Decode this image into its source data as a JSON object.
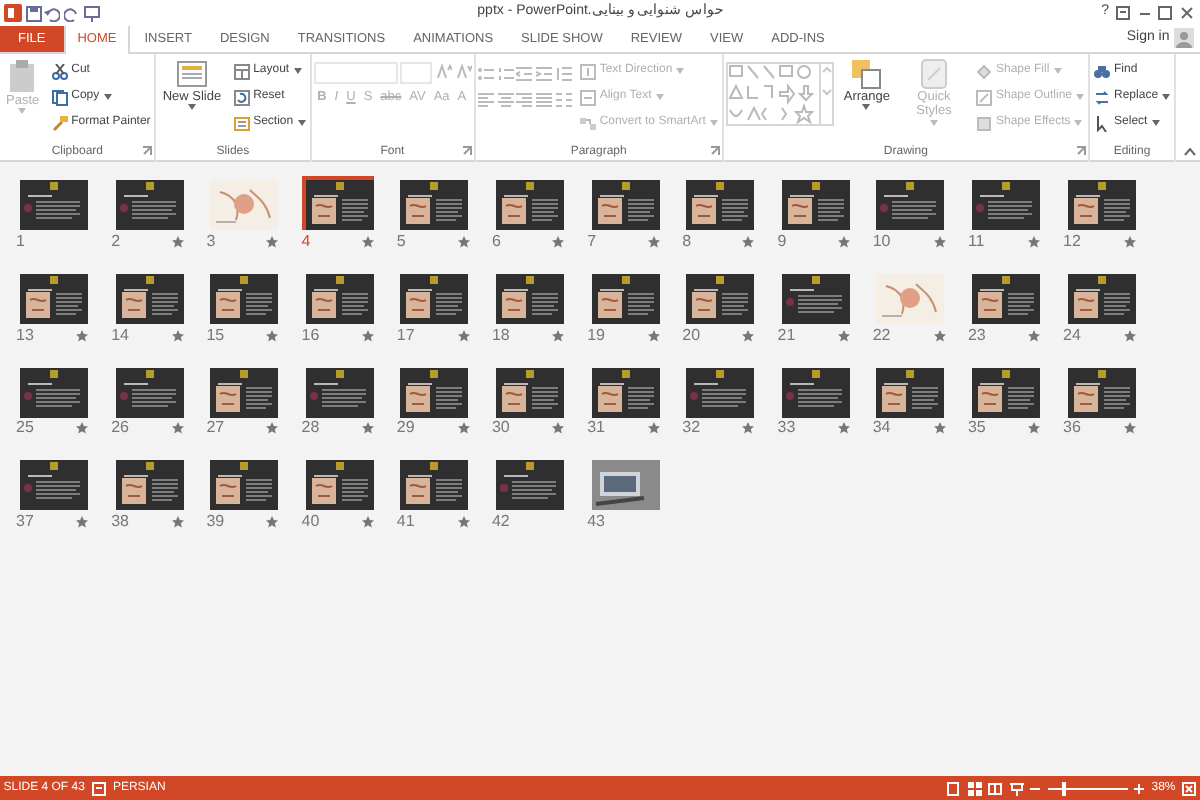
{
  "window": {
    "title": "حواس شنوایی و بینایی.pptx - PowerPoint",
    "help": "?",
    "sign_in": "Sign in"
  },
  "tabs": [
    {
      "label": "FILE",
      "kind": "file",
      "selected": false
    },
    {
      "label": "HOME",
      "kind": "tab",
      "selected": true
    },
    {
      "label": "INSERT",
      "kind": "tab",
      "selected": false
    },
    {
      "label": "DESIGN",
      "kind": "tab",
      "selected": false
    },
    {
      "label": "TRANSITIONS",
      "kind": "tab",
      "selected": false
    },
    {
      "label": "ANIMATIONS",
      "kind": "tab",
      "selected": false
    },
    {
      "label": "SLIDE SHOW",
      "kind": "tab",
      "selected": false
    },
    {
      "label": "REVIEW",
      "kind": "tab",
      "selected": false
    },
    {
      "label": "VIEW",
      "kind": "tab",
      "selected": false
    },
    {
      "label": "ADD-INS",
      "kind": "tab",
      "selected": false
    }
  ],
  "ribbon": {
    "groups": [
      {
        "label": "Clipboard",
        "launcher": true,
        "items": [
          {
            "kind": "large",
            "label": "Paste",
            "disabled": true,
            "dropdown": true
          },
          {
            "kind": "stack",
            "buttons": [
              {
                "label": "Cut",
                "disabled": false,
                "dropdown": false
              },
              {
                "label": "Copy",
                "disabled": false,
                "dropdown": true
              },
              {
                "label": "Format Painter",
                "disabled": false,
                "dropdown": false
              }
            ]
          }
        ]
      },
      {
        "label": "Slides",
        "launcher": false,
        "items": [
          {
            "kind": "large",
            "label": "New Slide",
            "disabled": false,
            "dropdown": true
          },
          {
            "kind": "stack",
            "buttons": [
              {
                "label": "Layout",
                "disabled": false,
                "dropdown": true
              },
              {
                "label": "Reset",
                "disabled": false,
                "dropdown": false
              },
              {
                "label": "Section",
                "disabled": false,
                "dropdown": true
              }
            ]
          }
        ]
      },
      {
        "label": "Font",
        "launcher": true,
        "items": [
          {
            "kind": "font",
            "disabled": true,
            "format_buttons": [
              "B",
              "I",
              "U",
              "S",
              "abc",
              "AV",
              "Aa",
              "A"
            ]
          }
        ]
      },
      {
        "label": "Paragraph",
        "launcher": true,
        "items": [
          {
            "kind": "paragraph",
            "disabled": true
          },
          {
            "kind": "stack",
            "buttons": [
              {
                "label": "Text Direction",
                "disabled": true,
                "dropdown": true
              },
              {
                "label": "Align Text",
                "disabled": true,
                "dropdown": true
              },
              {
                "label": "Convert to SmartArt",
                "disabled": true,
                "dropdown": true
              }
            ]
          }
        ]
      },
      {
        "label": "Drawing",
        "launcher": true,
        "items": [
          {
            "kind": "gallery",
            "disabled": true
          },
          {
            "kind": "large",
            "label": "Arrange",
            "disabled": false,
            "dropdown": true
          },
          {
            "kind": "large",
            "label": "Quick Styles",
            "disabled": true,
            "dropdown": true
          },
          {
            "kind": "stack",
            "buttons": [
              {
                "label": "Shape Fill",
                "disabled": true,
                "dropdown": true
              },
              {
                "label": "Shape Outline",
                "disabled": true,
                "dropdown": true
              },
              {
                "label": "Shape Effects",
                "disabled": true,
                "dropdown": true
              }
            ]
          }
        ]
      },
      {
        "label": "Editing",
        "launcher": false,
        "items": [
          {
            "kind": "stack",
            "buttons": [
              {
                "label": "Find",
                "disabled": false,
                "dropdown": false
              },
              {
                "label": "Replace",
                "disabled": false,
                "dropdown": true
              },
              {
                "label": "Select",
                "disabled": false,
                "dropdown": true
              }
            ]
          }
        ]
      }
    ]
  },
  "slides": [
    {
      "number": "1",
      "kind": "dark",
      "animated": false,
      "selected": false
    },
    {
      "number": "2",
      "kind": "dark",
      "animated": true,
      "selected": false
    },
    {
      "number": "3",
      "kind": "light",
      "animated": true,
      "selected": false
    },
    {
      "number": "4",
      "kind": "dark_image",
      "animated": true,
      "selected": true
    },
    {
      "number": "5",
      "kind": "dark_image",
      "animated": true,
      "selected": false
    },
    {
      "number": "6",
      "kind": "dark_image",
      "animated": true,
      "selected": false
    },
    {
      "number": "7",
      "kind": "dark_image",
      "animated": true,
      "selected": false
    },
    {
      "number": "8",
      "kind": "dark_image",
      "animated": true,
      "selected": false
    },
    {
      "number": "9",
      "kind": "dark_image",
      "animated": true,
      "selected": false
    },
    {
      "number": "10",
      "kind": "dark",
      "animated": true,
      "selected": false
    },
    {
      "number": "11",
      "kind": "dark",
      "animated": true,
      "selected": false
    },
    {
      "number": "12",
      "kind": "dark_image",
      "animated": true,
      "selected": false
    },
    {
      "number": "13",
      "kind": "dark_image",
      "animated": true,
      "selected": false
    },
    {
      "number": "14",
      "kind": "dark_image",
      "animated": true,
      "selected": false
    },
    {
      "number": "15",
      "kind": "dark_image",
      "animated": true,
      "selected": false
    },
    {
      "number": "16",
      "kind": "dark_image",
      "animated": true,
      "selected": false
    },
    {
      "number": "17",
      "kind": "dark_image",
      "animated": true,
      "selected": false
    },
    {
      "number": "18",
      "kind": "dark_image",
      "animated": true,
      "selected": false
    },
    {
      "number": "19",
      "kind": "dark_image",
      "animated": true,
      "selected": false
    },
    {
      "number": "20",
      "kind": "dark_image",
      "animated": true,
      "selected": false
    },
    {
      "number": "21",
      "kind": "dark",
      "animated": true,
      "selected": false
    },
    {
      "number": "22",
      "kind": "light",
      "animated": true,
      "selected": false
    },
    {
      "number": "23",
      "kind": "dark_image",
      "animated": true,
      "selected": false
    },
    {
      "number": "24",
      "kind": "dark_image",
      "animated": true,
      "selected": false
    },
    {
      "number": "25",
      "kind": "dark",
      "animated": true,
      "selected": false
    },
    {
      "number": "26",
      "kind": "dark",
      "animated": true,
      "selected": false
    },
    {
      "number": "27",
      "kind": "dark_image",
      "animated": true,
      "selected": false
    },
    {
      "number": "28",
      "kind": "dark",
      "animated": true,
      "selected": false
    },
    {
      "number": "29",
      "kind": "dark_image",
      "animated": true,
      "selected": false
    },
    {
      "number": "30",
      "kind": "dark_image",
      "animated": true,
      "selected": false
    },
    {
      "number": "31",
      "kind": "dark_image",
      "animated": true,
      "selected": false
    },
    {
      "number": "32",
      "kind": "dark",
      "animated": true,
      "selected": false
    },
    {
      "number": "33",
      "kind": "dark",
      "animated": true,
      "selected": false
    },
    {
      "number": "34",
      "kind": "dark_image",
      "animated": true,
      "selected": false
    },
    {
      "number": "35",
      "kind": "dark_image",
      "animated": true,
      "selected": false
    },
    {
      "number": "36",
      "kind": "dark_image",
      "animated": true,
      "selected": false
    },
    {
      "number": "37",
      "kind": "dark",
      "animated": true,
      "selected": false
    },
    {
      "number": "38",
      "kind": "dark_image",
      "animated": true,
      "selected": false
    },
    {
      "number": "39",
      "kind": "dark_image",
      "animated": true,
      "selected": false
    },
    {
      "number": "40",
      "kind": "dark_image",
      "animated": true,
      "selected": false
    },
    {
      "number": "41",
      "kind": "dark_image",
      "animated": true,
      "selected": false
    },
    {
      "number": "42",
      "kind": "dark",
      "animated": false,
      "selected": false
    },
    {
      "number": "43",
      "kind": "photo",
      "animated": false,
      "selected": false
    }
  ],
  "status_bar": {
    "slide_info": "SLIDE 4 OF 43",
    "language": "PERSIAN",
    "zoom": {
      "level": 0.18,
      "reading": "38%"
    }
  }
}
